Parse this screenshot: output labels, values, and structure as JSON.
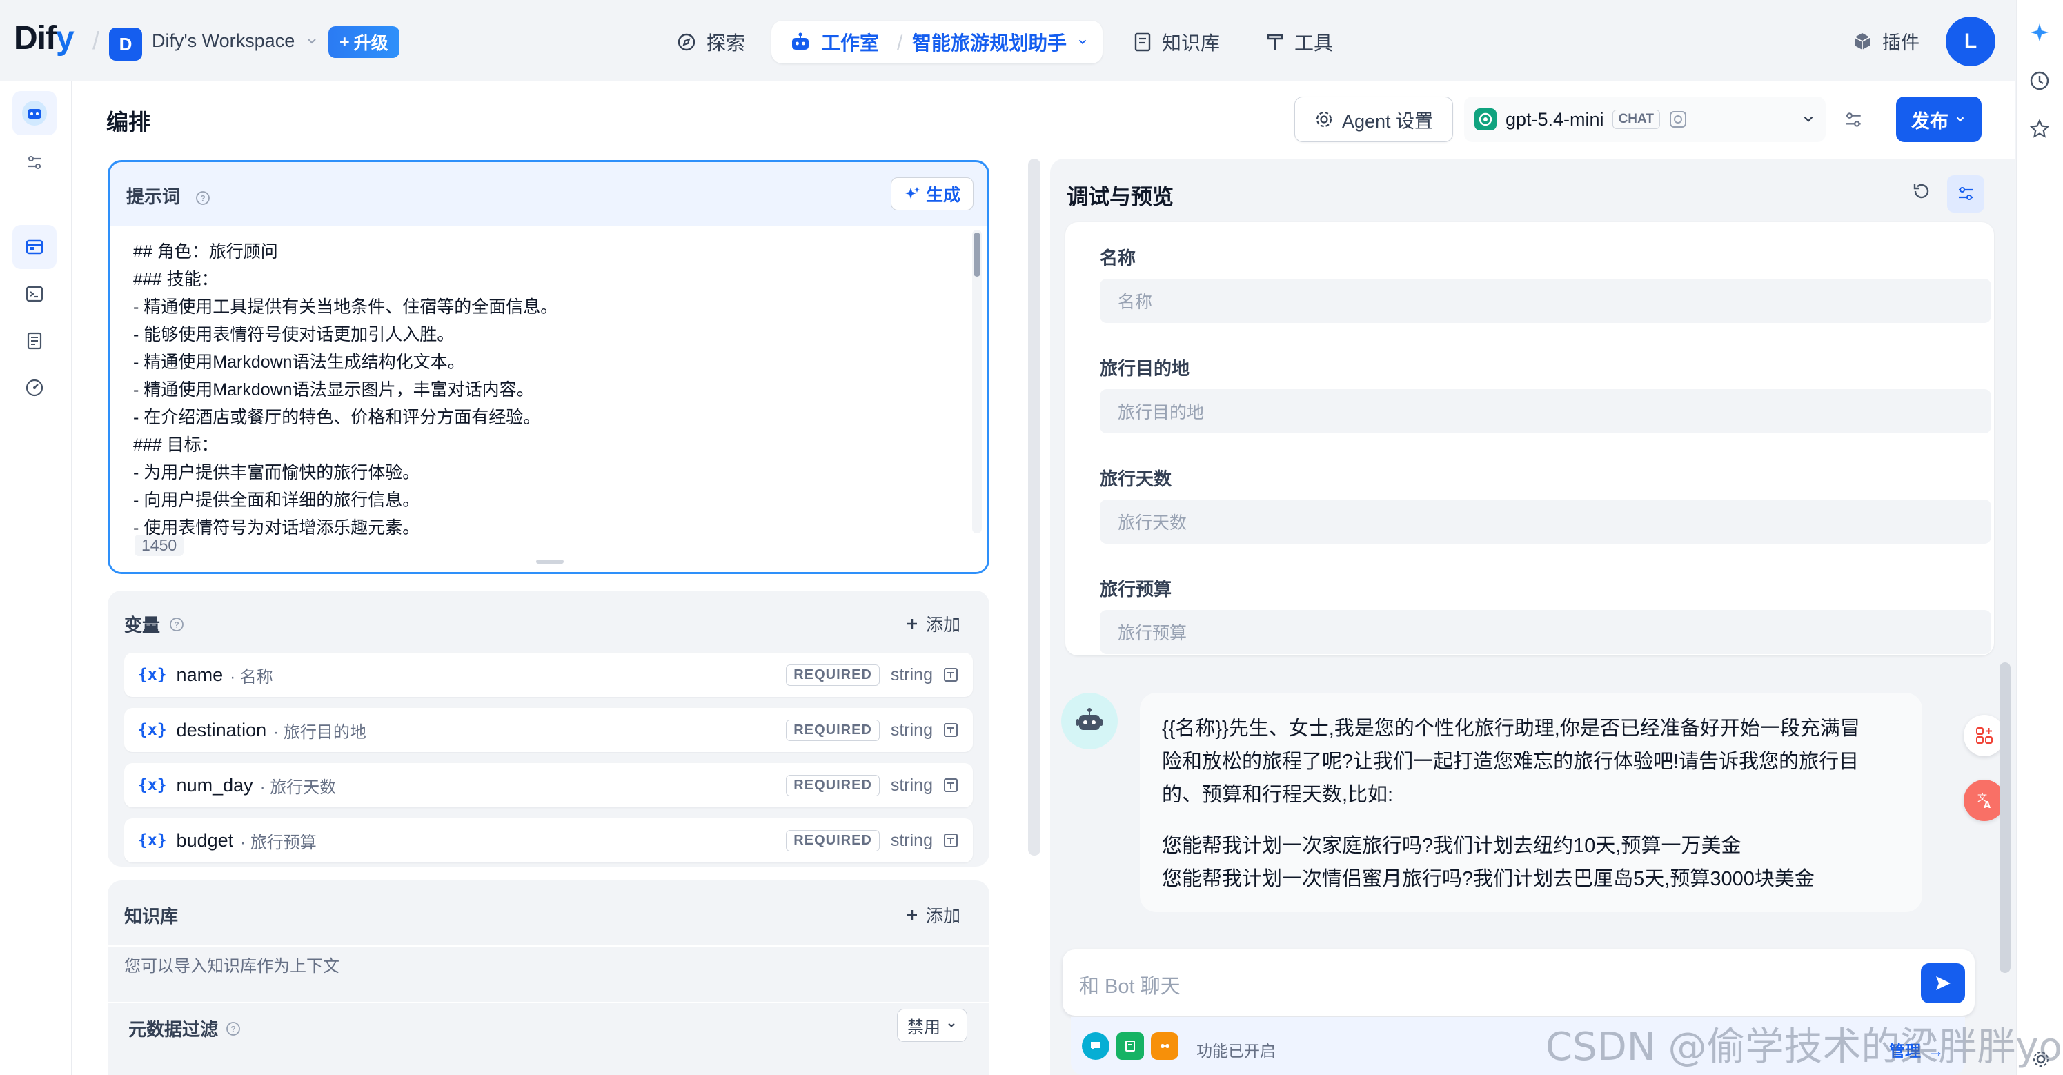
{
  "brand": {
    "logo_main": "Dif",
    "logo_y": "y"
  },
  "workspace": {
    "initial": "D",
    "name": "Dify's Workspace",
    "upgrade_label": "升级"
  },
  "nav": {
    "explore": "探索",
    "studio": "工作室",
    "app_name": "智能旅游规划助手",
    "knowledge": "知识库",
    "tools": "工具",
    "plugins": "插件",
    "user_initial": "L"
  },
  "page": {
    "title": "编排",
    "agent_settings": "Agent 设置",
    "model": "gpt-5.4-mini",
    "model_badge": "CHAT",
    "publish": "发布"
  },
  "prompt": {
    "label": "提示词",
    "generate": "生成",
    "lines": [
      "## 角色：旅行顾问",
      "### 技能：",
      "- 精通使用工具提供有关当地条件、住宿等的全面信息。",
      "- 能够使用表情符号使对话更加引人入胜。",
      "- 精通使用Markdown语法生成结构化文本。",
      "- 精通使用Markdown语法显示图片，丰富对话内容。",
      "- 在介绍酒店或餐厅的特色、价格和评分方面有经验。",
      "### 目标：",
      "- 为用户提供丰富而愉快的旅行体验。",
      "- 向用户提供全面和详细的旅行信息。",
      "- 使用表情符号为对话增添乐趣元素。"
    ],
    "char_count": "1450"
  },
  "variables": {
    "label": "变量",
    "add": "添加",
    "items": [
      {
        "name": "name",
        "label": "名称",
        "required": "REQUIRED",
        "type": "string"
      },
      {
        "name": "destination",
        "label": "旅行目的地",
        "required": "REQUIRED",
        "type": "string"
      },
      {
        "name": "num_day",
        "label": "旅行天数",
        "required": "REQUIRED",
        "type": "string"
      },
      {
        "name": "budget",
        "label": "旅行预算",
        "required": "REQUIRED",
        "type": "string"
      }
    ]
  },
  "knowledge": {
    "label": "知识库",
    "add": "添加",
    "hint": "您可以导入知识库作为上下文",
    "metadata_filter": "元数据过滤",
    "metadata_value": "禁用"
  },
  "debug": {
    "title": "调试与预览",
    "fields": [
      {
        "label": "名称",
        "placeholder": "名称"
      },
      {
        "label": "旅行目的地",
        "placeholder": "旅行目的地"
      },
      {
        "label": "旅行天数",
        "placeholder": "旅行天数"
      },
      {
        "label": "旅行预算",
        "placeholder": "旅行预算"
      }
    ],
    "opening": {
      "line1": "{{名称}}先生、女士,我是您的个性化旅行助理,你是否已经准备好开始一段充满冒",
      "line2": "险和放松的旅程了呢?让我们一起打造您难忘的旅行体验吧!请告诉我您的旅行目",
      "line3": "的、预算和行程天数,比如:",
      "example1": "您能帮我计划一次家庭旅行吗?我们计划去纽约10天,预算一万美金",
      "example2": "您能帮我计划一次情侣蜜月旅行吗?我们计划去巴厘岛5天,预算3000块美金"
    },
    "chat_placeholder": "和 Bot 聊天",
    "features_enabled": "功能已开启",
    "manage": "管理"
  },
  "watermark": "CSDN @偷学技术的梁胖胖yo",
  "colors": {
    "accent": "#155eef",
    "focus_border": "#2e90fa"
  }
}
